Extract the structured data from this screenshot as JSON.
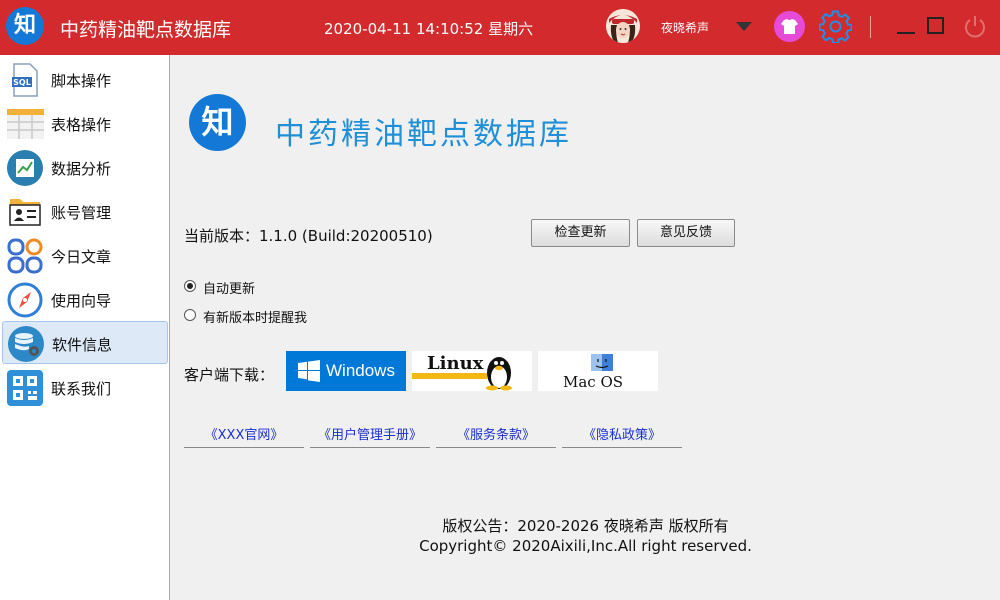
{
  "titlebar": {
    "logo_char": "知",
    "title": "中药精油靶点数据库",
    "datetime": "2020-04-11 14:10:52 星期六",
    "username": "夜晓希声",
    "icons": [
      "avatar",
      "chevron-down-icon",
      "skin-icon",
      "gear-icon",
      "minimize-icon",
      "maximize-icon",
      "power-icon"
    ]
  },
  "sidebar": {
    "items": [
      {
        "label": "脚本操作",
        "icon": "sql-script-icon",
        "active": false
      },
      {
        "label": "表格操作",
        "icon": "table-icon",
        "active": false
      },
      {
        "label": "数据分析",
        "icon": "chart-icon",
        "active": false
      },
      {
        "label": "账号管理",
        "icon": "id-card-icon",
        "active": false
      },
      {
        "label": "今日文章",
        "icon": "grid-circles-icon",
        "active": false
      },
      {
        "label": "使用向导",
        "icon": "compass-icon",
        "active": false
      },
      {
        "label": "软件信息",
        "icon": "database-gear-icon",
        "active": true
      },
      {
        "label": "联系我们",
        "icon": "qr-code-icon",
        "active": false
      }
    ]
  },
  "main": {
    "brand_logo_char": "知",
    "brand_title": "中药精油靶点数据库",
    "version_text": "当前版本：1.1.0 (Build:20200510)",
    "check_update_label": "检查更新",
    "feedback_label": "意见反馈",
    "radio_auto_update": "自动更新",
    "radio_notify": "有新版本时提醒我",
    "download_label": "客户端下载：",
    "download_windows": "Windows",
    "download_linux": "Linux",
    "download_mac": "Mac OS",
    "links": [
      "《XXX官网》",
      "《用户管理手册》",
      "《服务条款》",
      "《隐私政策》"
    ],
    "copyright_line1": "版权公告：2020-2026 夜晓希声 版权所有",
    "copyright_line2": "Copyright© 2020Aixili,Inc.All right reserved."
  },
  "colors": {
    "titlebar": "#d22a2d",
    "logo_blue": "#1479d6",
    "brand_title": "#1f8fd8",
    "link": "#1a2fd0",
    "windows_blue": "#0078d7",
    "active_nav": "#dde9f6"
  }
}
